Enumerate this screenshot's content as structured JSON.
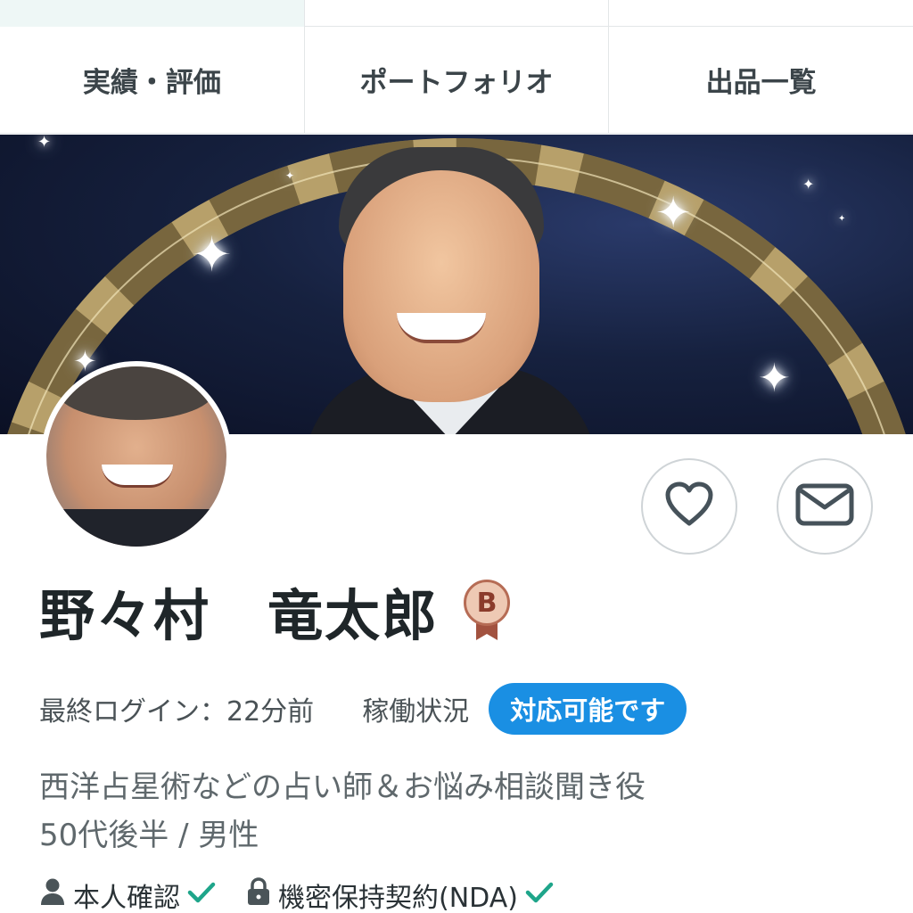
{
  "tabs": [
    {
      "label": "実績・評価"
    },
    {
      "label": "ポートフォリオ"
    },
    {
      "label": "出品一覧"
    }
  ],
  "profile": {
    "name": "野々村　竜太郎",
    "rank_badge": "B",
    "last_login_label": "最終ログイン：22分前",
    "work_status_label": "稼働状況",
    "work_status_value": "対応可能です",
    "tagline": "西洋占星術などの占い師＆お悩み相談聞き役",
    "age_gender": "50代後半 / 男性",
    "verifications": [
      {
        "label": "本人確認",
        "icon": "person-icon"
      },
      {
        "label": "機密保持契約(NDA)",
        "icon": "lock-icon"
      }
    ]
  },
  "actions": {
    "favorite_icon": "heart-icon",
    "message_icon": "envelope-icon"
  },
  "colors": {
    "accent_blue": "#1a8fe3",
    "check_green": "#1ea58a",
    "badge_bronze": "#b66c55"
  }
}
